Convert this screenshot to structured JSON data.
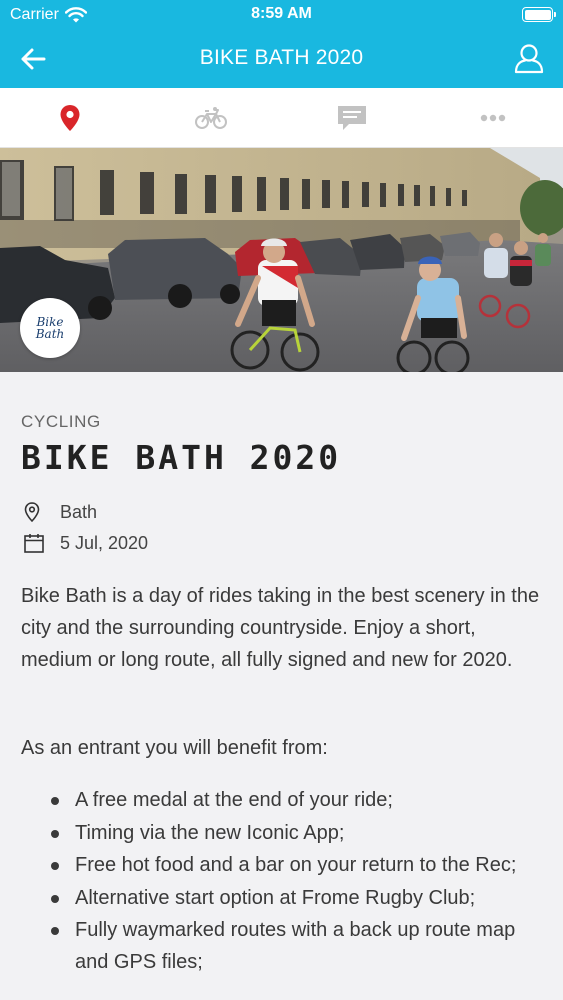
{
  "status_bar": {
    "carrier": "Carrier",
    "time": "8:59 AM",
    "battery_level": 1.0
  },
  "nav": {
    "title": "BIKE BATH 2020",
    "back_icon": "arrow-left-icon",
    "profile_icon": "user-icon"
  },
  "tabs": [
    {
      "icon": "location-pin-icon",
      "active": true,
      "color": "#d9262a"
    },
    {
      "icon": "bicycle-icon",
      "active": false,
      "color": "#c2c2c2"
    },
    {
      "icon": "chat-icon",
      "active": false,
      "color": "#c2c2c2"
    },
    {
      "icon": "more-icon",
      "active": false,
      "color": "#c2c2c2"
    }
  ],
  "hero": {
    "logo_line1": "Bike",
    "logo_line2": "Bath"
  },
  "event": {
    "category": "CYCLING",
    "title": "BIKE BATH 2020",
    "location": "Bath",
    "date": "5 Jul, 2020",
    "description": "Bike Bath is a day of rides taking in the best scenery in the city and the surrounding countryside. Enjoy a short, medium or long route, all fully signed and new for 2020.",
    "benefits_intro": "As an entrant you will benefit from:",
    "benefits": [
      "A free medal at the end of your ride;",
      "Timing via the new Iconic App;",
      "Free hot food and a bar on your return to the Rec;",
      "Alternative start option at Frome Rugby Club;",
      "Fully waymarked routes with a back up route map and GPS files;"
    ]
  },
  "colors": {
    "accent": "#19b8e0",
    "active_tab": "#d9262a",
    "background": "#f2f2f4"
  }
}
